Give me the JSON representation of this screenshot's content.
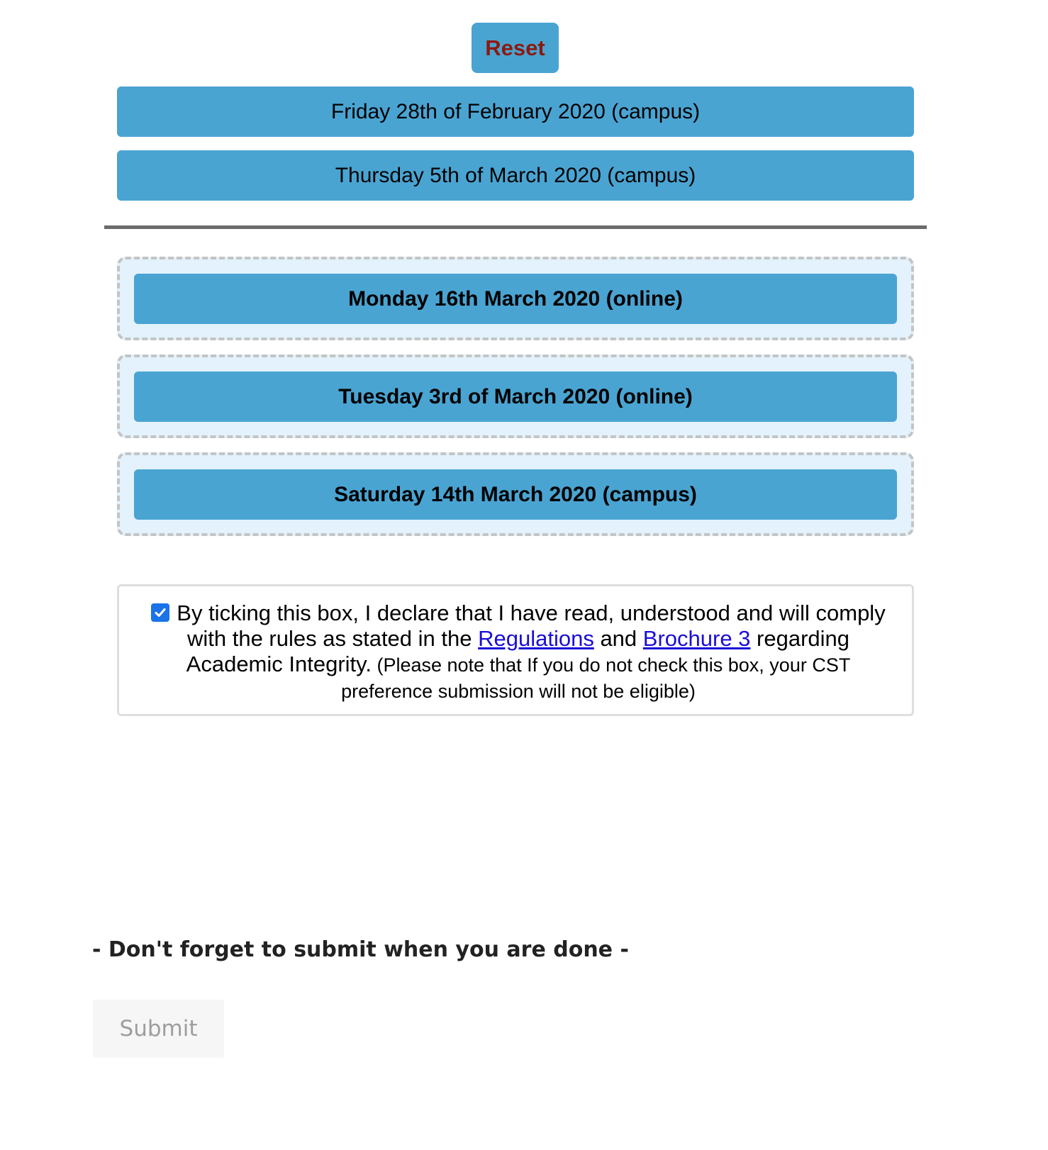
{
  "reset_label": "Reset",
  "available_dates": [
    "Friday 28th of February 2020 (campus)",
    "Thursday 5th of March 2020 (campus)"
  ],
  "preference_slots": [
    "Monday 16th March 2020 (online)",
    "Tuesday 3rd of March 2020 (online)",
    "Saturday 14th March 2020 (campus)"
  ],
  "declaration": {
    "checked": true,
    "text_before": "By ticking this box, I declare that I have read, understood and will comply with the rules as stated in the ",
    "link1": "Regulations",
    "text_and": " and ",
    "link2": "Brochure 3",
    "text_after": " regarding Academic Integrity.",
    "note": " (Please note that If you do not check this box, your CST preference submission will not be eligible)"
  },
  "reminder": "- Don't forget to submit when you are done -",
  "submit_label": "Submit",
  "colors": {
    "button_blue": "#4aa4d2",
    "reset_text": "#8b1a10",
    "zone_bg": "#e3f2fc",
    "link": "#1a0dd8"
  }
}
